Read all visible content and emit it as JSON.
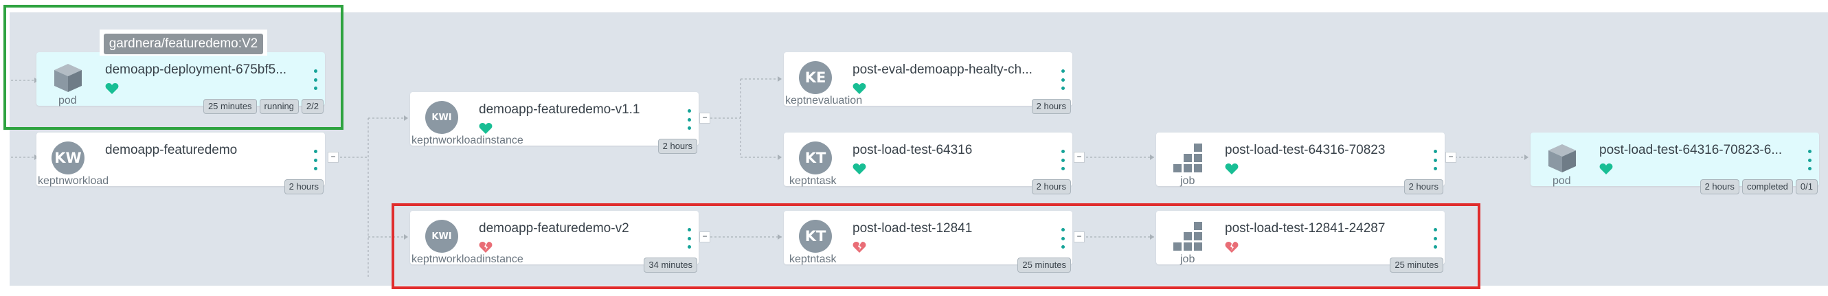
{
  "tooltip": {
    "text": "gardnera/featuredemo:V2"
  },
  "nodes": {
    "pod1": {
      "title": "demoapp-deployment-675bf5...",
      "kind": "pod",
      "icon": "cube-icon",
      "health": "healthy",
      "badges": [
        "25 minutes",
        "running",
        "2/2"
      ]
    },
    "workload": {
      "title": "demoapp-featuredemo",
      "kind": "keptnworkload",
      "icon_text": "KW",
      "health": "none",
      "badges": [
        "2 hours"
      ]
    },
    "kwi1": {
      "title": "demoapp-featuredemo-v1.1",
      "kind": "keptnworkloadinstance",
      "icon_text": "KWI",
      "health": "healthy",
      "badges": [
        "2 hours"
      ]
    },
    "kwi2": {
      "title": "demoapp-featuredemo-v2",
      "kind": "keptnworkloadinstance",
      "icon_text": "KWI",
      "health": "degraded",
      "badges": [
        "34 minutes"
      ]
    },
    "eval": {
      "title": "post-eval-demoapp-healty-ch...",
      "kind": "keptnevaluation",
      "icon_text": "KE",
      "health": "healthy",
      "badges": [
        "2 hours"
      ]
    },
    "task1": {
      "title": "post-load-test-64316",
      "kind": "keptntask",
      "icon_text": "KT",
      "health": "healthy",
      "badges": [
        "2 hours"
      ]
    },
    "task2": {
      "title": "post-load-test-12841",
      "kind": "keptntask",
      "icon_text": "KT",
      "health": "degraded",
      "badges": [
        "25 minutes"
      ]
    },
    "job1": {
      "title": "post-load-test-64316-70823",
      "kind": "job",
      "icon": "job-icon",
      "health": "healthy",
      "badges": [
        "2 hours"
      ]
    },
    "job2": {
      "title": "post-load-test-12841-24287",
      "kind": "job",
      "icon": "job-icon",
      "health": "degraded",
      "badges": [
        "25 minutes"
      ]
    },
    "pod2": {
      "title": "post-load-test-64316-70823-6...",
      "kind": "pod",
      "icon": "cube-icon",
      "health": "healthy",
      "badges": [
        "2 hours",
        "completed",
        "0/1"
      ]
    }
  },
  "collapse_label": "−",
  "colors": {
    "healthy": "#18be94",
    "degraded": "#e96d76",
    "menu": "#15a398",
    "highlight_green": "#2ea340",
    "highlight_red": "#e02d2d",
    "canvas": "#dde3ea",
    "pod_bg": "#e0fafd"
  }
}
